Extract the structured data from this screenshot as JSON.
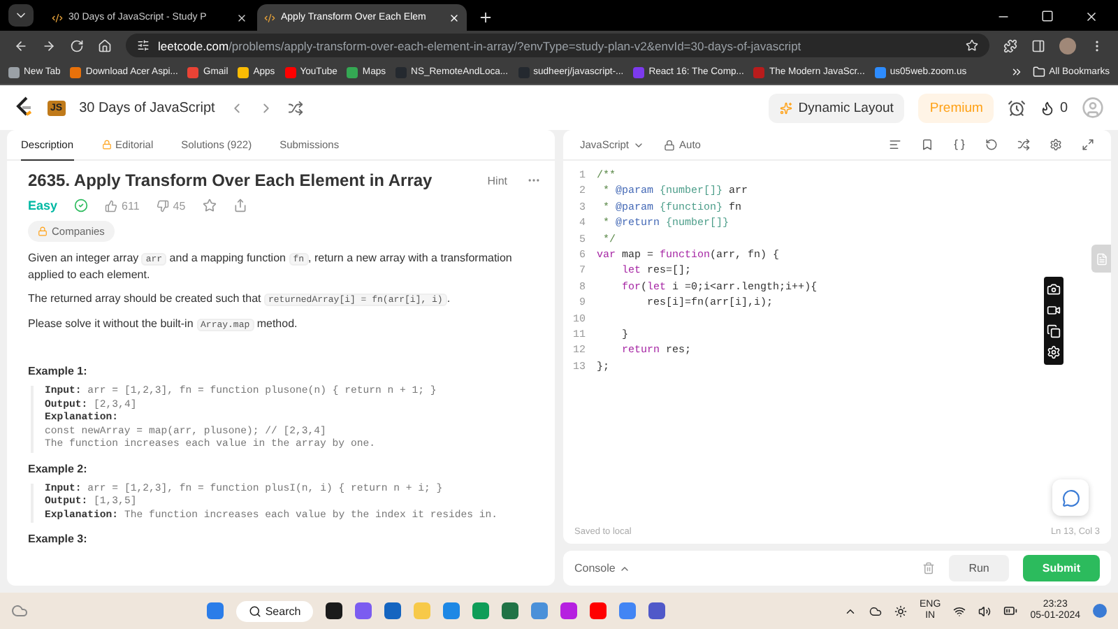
{
  "browser": {
    "tabs": [
      {
        "title": "30 Days of JavaScript - Study P",
        "selected": false
      },
      {
        "title": "Apply Transform Over Each Elem",
        "selected": true
      }
    ],
    "url": {
      "host": "leetcode.com",
      "path": "/problems/apply-transform-over-each-element-in-array/?envType=study-plan-v2&envId=30-days-of-javascript"
    },
    "bookmarks": [
      {
        "label": "New Tab",
        "color": "#9aa0a6"
      },
      {
        "label": "Download Acer Aspi...",
        "color": "#e8710a"
      },
      {
        "label": "Gmail",
        "color": "#ea4335"
      },
      {
        "label": "Apps",
        "color": "#fbbc04"
      },
      {
        "label": "YouTube",
        "color": "#ff0000"
      },
      {
        "label": "Maps",
        "color": "#34a853"
      },
      {
        "label": "NS_RemoteAndLoca...",
        "color": "#24292f"
      },
      {
        "label": "sudheerj/javascript-...",
        "color": "#24292f"
      },
      {
        "label": "React 16: The Comp...",
        "color": "#7c3aed"
      },
      {
        "label": "The Modern JavaScr...",
        "color": "#b91c1c"
      },
      {
        "label": "us05web.zoom.us",
        "color": "#2d8cff"
      }
    ],
    "all_bookmarks": "All Bookmarks"
  },
  "nav": {
    "badge": "JS",
    "study_plan": "30 Days of JavaScript",
    "dynamic_layout": "Dynamic Layout",
    "premium": "Premium",
    "streak": "0"
  },
  "description": {
    "tabs": [
      {
        "label": "Description",
        "selected": true
      },
      {
        "label": "Editorial",
        "selected": false
      },
      {
        "label": "Solutions (922)",
        "selected": false
      },
      {
        "label": "Submissions",
        "selected": false
      }
    ],
    "title": "2635. Apply Transform Over Each Element in Array",
    "hint": "Hint",
    "difficulty": "Easy",
    "solved": true,
    "likes": "611",
    "dislikes": "45",
    "companies": "Companies",
    "paragraphs": [
      [
        {
          "kind": "text",
          "text": "Given an integer array "
        },
        {
          "kind": "code",
          "text": "arr"
        },
        {
          "kind": "text",
          "text": " and a mapping function "
        },
        {
          "kind": "code",
          "text": "fn"
        },
        {
          "kind": "text",
          "text": ", return a new array with a transformation applied to each element."
        }
      ],
      [
        {
          "kind": "text",
          "text": "The returned array should be created such that "
        },
        {
          "kind": "code",
          "text": "returnedArray[i] = fn(arr[i], i)"
        },
        {
          "kind": "text",
          "text": "."
        }
      ],
      [
        {
          "kind": "text",
          "text": "Please solve it without the built-in "
        },
        {
          "kind": "code",
          "text": "Array.map"
        },
        {
          "kind": "text",
          "text": " method."
        }
      ]
    ],
    "examples": [
      {
        "title": "Example 1:",
        "lines": [
          {
            "label": "Input:",
            "text": "arr = [1,2,3], fn = function plusone(n) { return n + 1; }"
          },
          {
            "label": "Output:",
            "text": "[2,3,4]"
          },
          {
            "label": "Explanation:"
          },
          {
            "text": "const newArray = map(arr, plusone); // [2,3,4]"
          },
          {
            "text": "The function increases each value in the array by one."
          }
        ]
      },
      {
        "title": "Example 2:",
        "lines": [
          {
            "label": "Input:",
            "text": "arr = [1,2,3], fn = function plusI(n, i) { return n + i; }"
          },
          {
            "label": "Output:",
            "text": "[1,3,5]"
          },
          {
            "label": "Explanation:",
            "text": "The function increases each value by the index it resides in."
          }
        ]
      },
      {
        "title": "Example 3:"
      }
    ]
  },
  "editor": {
    "language": "JavaScript",
    "mode": "Auto",
    "code": [
      {
        "number": "1",
        "tokens": [
          {
            "kind": "comment",
            "text": "/**"
          }
        ]
      },
      {
        "number": "2",
        "tokens": [
          {
            "kind": "comment",
            "text": " * "
          },
          {
            "kind": "tag",
            "text": "@param"
          },
          {
            "kind": "type",
            "text": " {number[]}"
          },
          {
            "kind": "plain",
            "text": " arr"
          }
        ]
      },
      {
        "number": "3",
        "tokens": [
          {
            "kind": "comment",
            "text": " * "
          },
          {
            "kind": "tag",
            "text": "@param"
          },
          {
            "kind": "type",
            "text": " {function}"
          },
          {
            "kind": "plain",
            "text": " fn"
          }
        ]
      },
      {
        "number": "4",
        "tokens": [
          {
            "kind": "comment",
            "text": " * "
          },
          {
            "kind": "tag",
            "text": "@return"
          },
          {
            "kind": "type",
            "text": " {number[]}"
          }
        ]
      },
      {
        "number": "5",
        "tokens": [
          {
            "kind": "comment",
            "text": " */"
          }
        ]
      },
      {
        "number": "6",
        "tokens": [
          {
            "kind": "keyword",
            "text": "var"
          },
          {
            "kind": "plain",
            "text": " map = "
          },
          {
            "kind": "keyword",
            "text": "function"
          },
          {
            "kind": "plain",
            "text": "(arr, fn) {"
          }
        ]
      },
      {
        "number": "7",
        "tokens": [
          {
            "kind": "keyword",
            "text": "    let"
          },
          {
            "kind": "plain",
            "text": " res=[];"
          }
        ]
      },
      {
        "number": "8",
        "tokens": [
          {
            "kind": "keyword",
            "text": "    for"
          },
          {
            "kind": "plain",
            "text": "("
          },
          {
            "kind": "keyword",
            "text": "let"
          },
          {
            "kind": "plain",
            "text": " i =0;i<arr.length;i++){"
          }
        ]
      },
      {
        "number": "9",
        "tokens": [
          {
            "kind": "plain",
            "text": "        res[i]=fn(arr[i],i);"
          }
        ]
      },
      {
        "number": "10"
      },
      {
        "number": "11",
        "tokens": [
          {
            "kind": "plain",
            "text": "    }"
          }
        ]
      },
      {
        "number": "12",
        "tokens": [
          {
            "kind": "keyword",
            "text": "    return"
          },
          {
            "kind": "plain",
            "text": " res;"
          }
        ]
      },
      {
        "number": "13",
        "tokens": [
          {
            "kind": "plain",
            "text": "};"
          }
        ]
      }
    ],
    "status": "Saved to local",
    "cursor": "Ln 13, Col 3",
    "console": "Console",
    "run": "Run",
    "submit": "Submit"
  },
  "taskbar": {
    "search": "Search",
    "lang": "ENG",
    "region": "IN",
    "time": "23:23",
    "date": "05-01-2024"
  }
}
